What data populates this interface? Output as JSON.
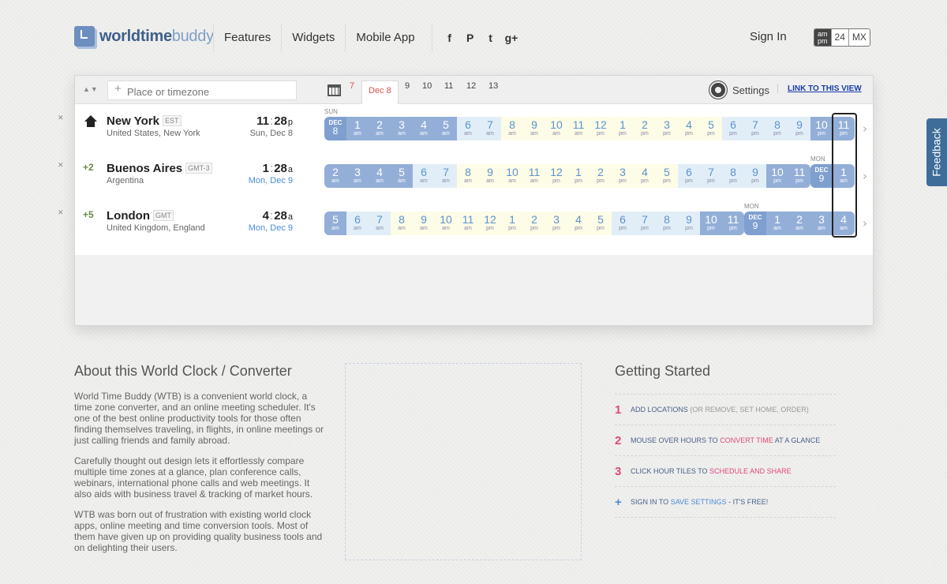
{
  "header": {
    "logo": {
      "part1": "world",
      "part2": "time",
      "part3": "buddy"
    },
    "nav": [
      "Features",
      "Widgets",
      "Mobile App"
    ],
    "social": [
      {
        "icon": "facebook-icon",
        "glyph": "f"
      },
      {
        "icon": "pinterest-icon",
        "glyph": "P"
      },
      {
        "icon": "twitter-icon",
        "glyph": "t"
      },
      {
        "icon": "google-plus-icon",
        "glyph": "g+"
      }
    ],
    "sign_in": "Sign In",
    "formats": {
      "ampm_top": "am",
      "ampm_bottom": "pm",
      "h24": "24",
      "mx": "MX",
      "selected": "ampm"
    }
  },
  "toolbar": {
    "search_placeholder": "Place or timezone",
    "dates": [
      "7",
      "Dec 8",
      "9",
      "10",
      "11",
      "12",
      "13"
    ],
    "selected_date": "Dec 8",
    "settings_label": "Settings",
    "link_label": "LINK TO THIS VIEW"
  },
  "rows": [
    {
      "home": true,
      "offset": "",
      "city": "New York",
      "tz": "EST",
      "country": "United States, New York",
      "time_h": "11",
      "time_m": "28",
      "time_ap": "p",
      "date": "Sun, Dec 8",
      "date_blue": false,
      "day_label": "SUN",
      "day_label_idx": 0,
      "hours": [
        {
          "h": "DEC",
          "s": "8",
          "k": "dy"
        },
        {
          "h": "1",
          "s": "am",
          "k": "n"
        },
        {
          "h": "2",
          "s": "am",
          "k": "n"
        },
        {
          "h": "3",
          "s": "am",
          "k": "n"
        },
        {
          "h": "4",
          "s": "am",
          "k": "n"
        },
        {
          "h": "5",
          "s": "am",
          "k": "n"
        },
        {
          "h": "6",
          "s": "am",
          "k": "d"
        },
        {
          "h": "7",
          "s": "am",
          "k": "d"
        },
        {
          "h": "8",
          "s": "am",
          "k": "b"
        },
        {
          "h": "9",
          "s": "am",
          "k": "b"
        },
        {
          "h": "10",
          "s": "am",
          "k": "b"
        },
        {
          "h": "11",
          "s": "am",
          "k": "b"
        },
        {
          "h": "12",
          "s": "pm",
          "k": "b"
        },
        {
          "h": "1",
          "s": "pm",
          "k": "b"
        },
        {
          "h": "2",
          "s": "pm",
          "k": "b"
        },
        {
          "h": "3",
          "s": "pm",
          "k": "b"
        },
        {
          "h": "4",
          "s": "pm",
          "k": "b"
        },
        {
          "h": "5",
          "s": "pm",
          "k": "b"
        },
        {
          "h": "6",
          "s": "pm",
          "k": "d"
        },
        {
          "h": "7",
          "s": "pm",
          "k": "d"
        },
        {
          "h": "8",
          "s": "pm",
          "k": "d"
        },
        {
          "h": "9",
          "s": "pm",
          "k": "d"
        },
        {
          "h": "10",
          "s": "pm",
          "k": "n"
        },
        {
          "h": "11",
          "s": "pm",
          "k": "n"
        }
      ]
    },
    {
      "home": false,
      "offset": "+2",
      "city": "Buenos Aires",
      "tz": "GMT-3",
      "country": "Argentina",
      "time_h": "1",
      "time_m": "28",
      "time_ap": "a",
      "date": "Mon, Dec 9",
      "date_blue": true,
      "day_label": "MON",
      "day_label_idx": 22,
      "hours": [
        {
          "h": "2",
          "s": "am",
          "k": "n"
        },
        {
          "h": "3",
          "s": "am",
          "k": "n"
        },
        {
          "h": "4",
          "s": "am",
          "k": "n"
        },
        {
          "h": "5",
          "s": "am",
          "k": "n"
        },
        {
          "h": "6",
          "s": "am",
          "k": "d"
        },
        {
          "h": "7",
          "s": "am",
          "k": "d"
        },
        {
          "h": "8",
          "s": "am",
          "k": "b"
        },
        {
          "h": "9",
          "s": "am",
          "k": "b"
        },
        {
          "h": "10",
          "s": "am",
          "k": "b"
        },
        {
          "h": "11",
          "s": "am",
          "k": "b"
        },
        {
          "h": "12",
          "s": "pm",
          "k": "b"
        },
        {
          "h": "1",
          "s": "pm",
          "k": "b"
        },
        {
          "h": "2",
          "s": "pm",
          "k": "b"
        },
        {
          "h": "3",
          "s": "pm",
          "k": "b"
        },
        {
          "h": "4",
          "s": "pm",
          "k": "b"
        },
        {
          "h": "5",
          "s": "pm",
          "k": "b"
        },
        {
          "h": "6",
          "s": "pm",
          "k": "d"
        },
        {
          "h": "7",
          "s": "pm",
          "k": "d"
        },
        {
          "h": "8",
          "s": "pm",
          "k": "d"
        },
        {
          "h": "9",
          "s": "pm",
          "k": "d"
        },
        {
          "h": "10",
          "s": "pm",
          "k": "n"
        },
        {
          "h": "11",
          "s": "pm",
          "k": "n"
        },
        {
          "h": "DEC",
          "s": "9",
          "k": "dy"
        },
        {
          "h": "1",
          "s": "am",
          "k": "n"
        }
      ]
    },
    {
      "home": false,
      "offset": "+5",
      "city": "London",
      "tz": "GMT",
      "country": "United Kingdom, England",
      "time_h": "4",
      "time_m": "28",
      "time_ap": "a",
      "date": "Mon, Dec 9",
      "date_blue": true,
      "day_label": "MON",
      "day_label_idx": 19,
      "hours": [
        {
          "h": "5",
          "s": "am",
          "k": "n"
        },
        {
          "h": "6",
          "s": "am",
          "k": "d"
        },
        {
          "h": "7",
          "s": "am",
          "k": "d"
        },
        {
          "h": "8",
          "s": "am",
          "k": "b"
        },
        {
          "h": "9",
          "s": "am",
          "k": "b"
        },
        {
          "h": "10",
          "s": "am",
          "k": "b"
        },
        {
          "h": "11",
          "s": "am",
          "k": "b"
        },
        {
          "h": "12",
          "s": "pm",
          "k": "b"
        },
        {
          "h": "1",
          "s": "pm",
          "k": "b"
        },
        {
          "h": "2",
          "s": "pm",
          "k": "b"
        },
        {
          "h": "3",
          "s": "pm",
          "k": "b"
        },
        {
          "h": "4",
          "s": "pm",
          "k": "b"
        },
        {
          "h": "5",
          "s": "pm",
          "k": "b"
        },
        {
          "h": "6",
          "s": "pm",
          "k": "d"
        },
        {
          "h": "7",
          "s": "pm",
          "k": "d"
        },
        {
          "h": "8",
          "s": "pm",
          "k": "d"
        },
        {
          "h": "9",
          "s": "pm",
          "k": "d"
        },
        {
          "h": "10",
          "s": "pm",
          "k": "n"
        },
        {
          "h": "11",
          "s": "pm",
          "k": "n"
        },
        {
          "h": "DEC",
          "s": "9",
          "k": "dy"
        },
        {
          "h": "1",
          "s": "am",
          "k": "n"
        },
        {
          "h": "2",
          "s": "am",
          "k": "n"
        },
        {
          "h": "3",
          "s": "am",
          "k": "n"
        },
        {
          "h": "4",
          "s": "am",
          "k": "n"
        }
      ]
    }
  ],
  "feedback_label": "Feedback",
  "about": {
    "title": "About this World Clock / Converter",
    "p1": "World Time Buddy (WTB) is a convenient world clock, a time zone converter, and an online meeting scheduler. It's one of the best online productivity tools for those often finding themselves traveling, in flights, in online meetings or just calling friends and family abroad.",
    "p2": "Carefully thought out design lets it effortlessly compare multiple time zones at a glance, plan conference calls, webinars, international phone calls and web meetings. It also aids with business travel & tracking of market hours.",
    "p3": "WTB was born out of frustration with existing world clock apps, online meeting and time conversion tools. Most of them have given up on providing quality business tools and on delighting their users."
  },
  "getting_started": {
    "title": "Getting Started",
    "steps": [
      {
        "num": "1",
        "a": "ADD LOCATIONS",
        "b": "(OR REMOVE, SET HOME, ORDER)",
        "c": ""
      },
      {
        "num": "2",
        "a": "MOUSE OVER HOURS TO",
        "b": "CONVERT TIME",
        "c": "AT A GLANCE"
      },
      {
        "num": "3",
        "a": "CLICK HOUR TILES TO",
        "b": "SCHEDULE AND SHARE",
        "c": ""
      },
      {
        "num": "+",
        "a": "SIGN IN TO",
        "b": "SAVE SETTINGS",
        "c": "- IT'S FREE!"
      }
    ]
  }
}
